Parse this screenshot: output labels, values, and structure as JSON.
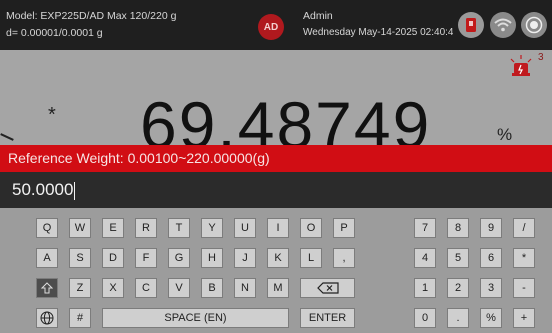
{
  "header": {
    "model_text": "Model: EXP225D/AD   Max 120/220 g",
    "d_text": "d= 0.00001/0.0001 g",
    "avatar_initials": "AD",
    "user_name": "Admin",
    "datetime": "Wednesday May-14-2025 02:40:43 PM",
    "icons": [
      "usb-icon",
      "wifi-icon",
      "target-icon"
    ]
  },
  "display": {
    "marker": "*",
    "weight": "69.48749",
    "unit": "%",
    "alarm_count": "3"
  },
  "reference": {
    "label": "Reference Weight: 0.00100~220.00000(g)"
  },
  "input": {
    "value": "50.0000"
  },
  "keyboard": {
    "rows": [
      [
        "Q",
        "W",
        "E",
        "R",
        "T",
        "Y",
        "U",
        "I",
        "O",
        "P"
      ],
      [
        "A",
        "S",
        "D",
        "F",
        "G",
        "H",
        "J",
        "K",
        "L",
        ","
      ],
      [
        "Z",
        "X",
        "C",
        "V",
        "B",
        "N",
        "M"
      ]
    ],
    "hash": "#",
    "space_label": "SPACE (EN)",
    "enter_label": "ENTER",
    "numpad": [
      [
        "7",
        "8",
        "9",
        "/"
      ],
      [
        "4",
        "5",
        "6",
        "*"
      ],
      [
        "1",
        "2",
        "3",
        "-"
      ],
      [
        "0",
        ".",
        "%",
        "+"
      ]
    ]
  }
}
